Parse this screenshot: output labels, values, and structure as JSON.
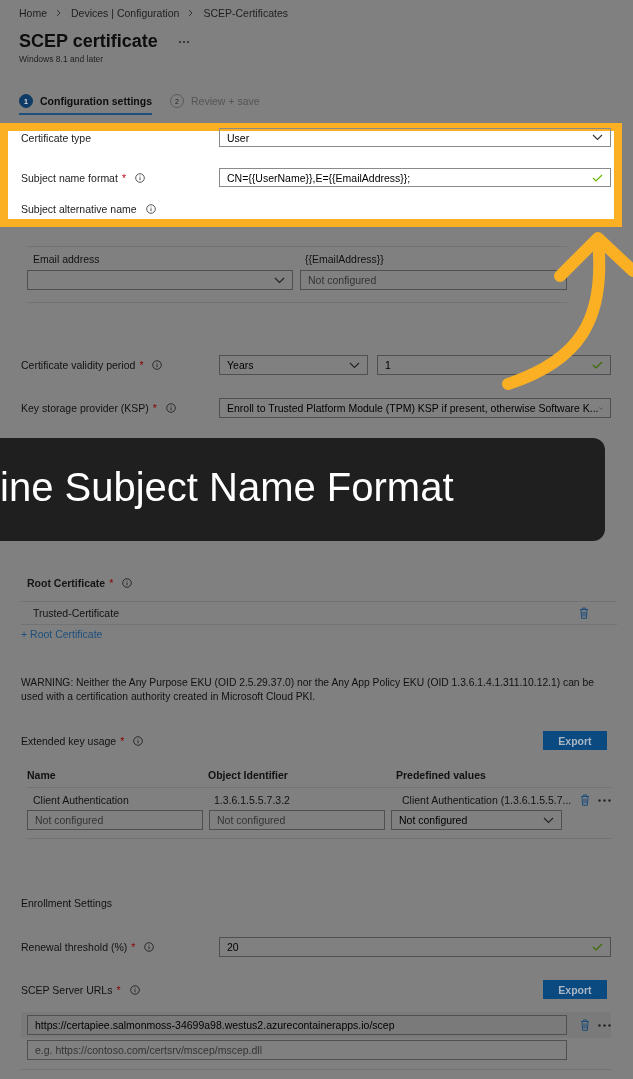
{
  "breadcrumb": [
    "Home",
    "Devices | Configuration",
    "SCEP-Certificates"
  ],
  "title": "SCEP certificate",
  "subtitle": "Windows 8.1 and later",
  "steps": [
    {
      "number": "1",
      "label": "Configuration settings",
      "selected": true
    },
    {
      "number": "2",
      "label": "Review + save",
      "selected": false
    }
  ],
  "highlight": [
    {
      "kind": "select",
      "label": "Certificate type",
      "value": "User"
    },
    {
      "kind": "text",
      "label": "Subject name format",
      "required_mark": "*",
      "value": "CN={{UserName}},E={{EmailAddress}};",
      "valid": true
    },
    {
      "kind": "heading",
      "label": "Subject alternative name"
    }
  ],
  "san_row": {
    "attribute": "Email address",
    "value": "{{EmailAddress}}",
    "value_placeholder": "Not configured"
  },
  "fields": [
    {
      "kind": "select-text",
      "label": "Certificate validity period",
      "required_mark": "*",
      "select": "Years",
      "value": "1",
      "valid": true
    },
    {
      "kind": "select",
      "label": "Key storage provider (KSP)",
      "required_mark": "*",
      "value": "Enroll to Trusted Platform Module (TPM) KSP if present, otherwise Software K..."
    },
    {
      "kind": "banner"
    }
  ],
  "root_certificate": {
    "label": "Root Certificate",
    "required_mark": "*",
    "items": [
      "Trusted-Certificate"
    ],
    "add_link": "+ Root Certificate"
  },
  "warning": "WARNING: Neither the Any Purpose EKU (OID 2.5.29.37.0) nor the Any App Policy EKU (OID 1.3.6.1.4.1.311.10.12.1) can be used with a certification authority created in Microsoft Cloud PKI.",
  "eku": {
    "label": "Extended key usage",
    "required_mark": "*",
    "export": "Export",
    "columns": [
      "Name",
      "Object Identifier",
      "Predefined values"
    ],
    "rows": [
      [
        "Client Authentication",
        "1.3.6.1.5.5.7.3.2",
        "Client Authentication (1.3.6.1.5.5.7..."
      ]
    ],
    "name_placeholder": "Not configured",
    "oid_placeholder": "Not configured",
    "predefined_value": "Not configured"
  },
  "enrollment": {
    "heading": "Enrollment Settings",
    "renewal": {
      "label": "Renewal threshold (%)",
      "required_mark": "*",
      "value": "20",
      "valid": true
    },
    "scep": {
      "label": "SCEP Server URLs",
      "required_mark": "*",
      "export": "Export",
      "urls": [
        "https://certapiee.salmonmoss-34699a98.westus2.azurecontainerapps.io/scep"
      ],
      "placeholder": "e.g. https://contoso.com/certsrv/mscep/mscep.dll"
    }
  },
  "caption": "ine Subject Name Format"
}
